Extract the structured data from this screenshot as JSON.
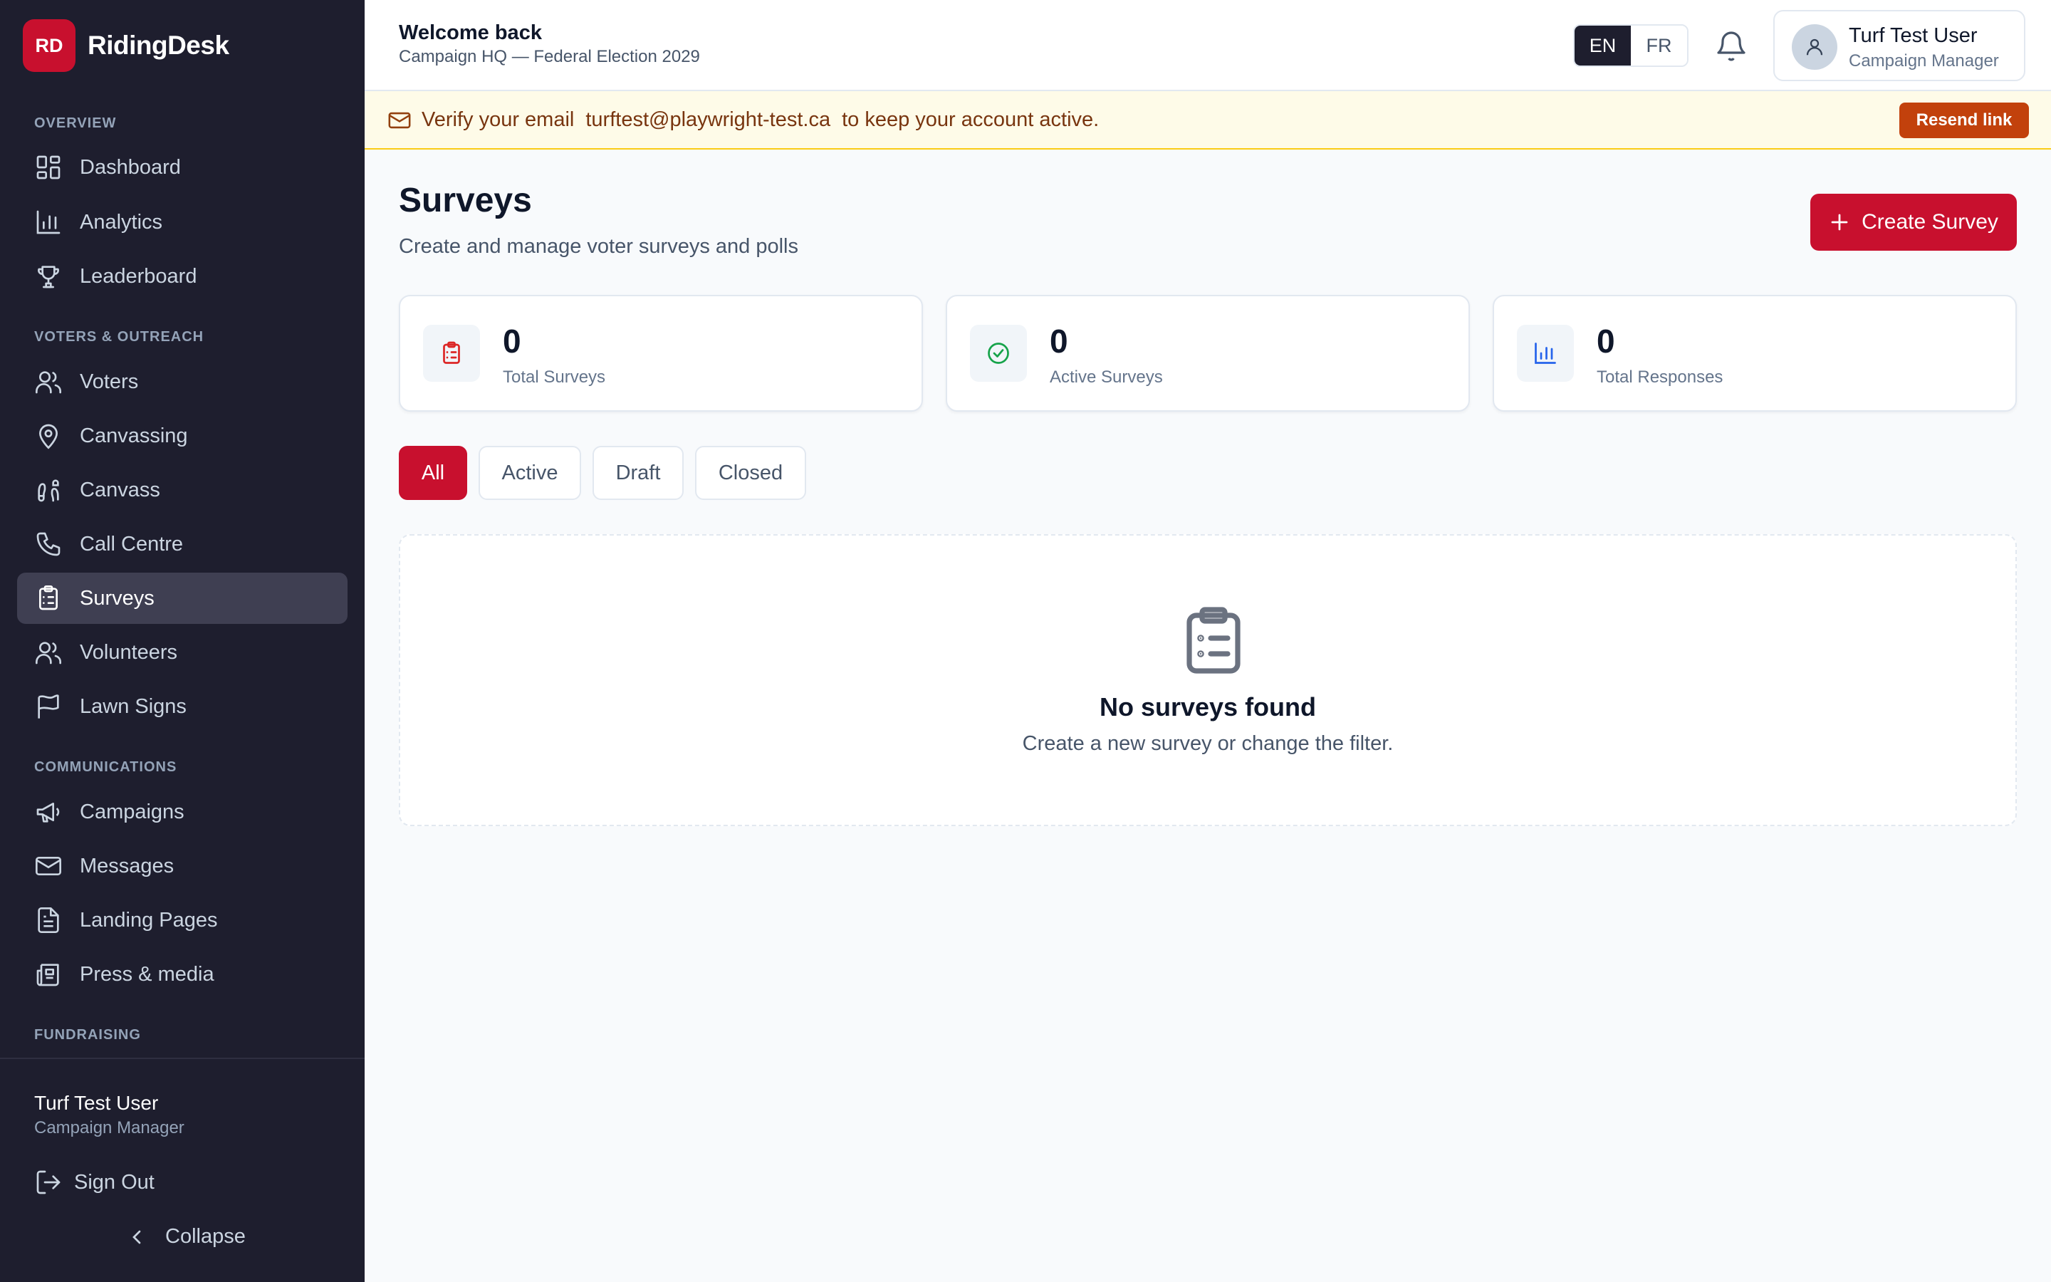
{
  "brand": {
    "logo": "RD",
    "name": "RidingDesk"
  },
  "sidebar": {
    "sections": {
      "overview": "OVERVIEW",
      "voters_outreach": "VOTERS & OUTREACH",
      "communications": "COMMUNICATIONS",
      "fundraising": "FUNDRAISING"
    },
    "items": {
      "dashboard": {
        "label": "Dashboard",
        "icon": "dashboard-icon"
      },
      "analytics": {
        "label": "Analytics",
        "icon": "bar-chart-icon"
      },
      "leaderboard": {
        "label": "Leaderboard",
        "icon": "trophy-icon"
      },
      "voters": {
        "label": "Voters",
        "icon": "users-icon"
      },
      "canvassing": {
        "label": "Canvassing",
        "icon": "map-pin-icon"
      },
      "canvass": {
        "label": "Canvass",
        "icon": "footprints-icon"
      },
      "call_centre": {
        "label": "Call Centre",
        "icon": "phone-icon"
      },
      "surveys": {
        "label": "Surveys",
        "icon": "clipboard-list-icon",
        "active": true
      },
      "volunteers": {
        "label": "Volunteers",
        "icon": "users-icon"
      },
      "lawn_signs": {
        "label": "Lawn Signs",
        "icon": "flag-icon"
      },
      "campaigns": {
        "label": "Campaigns",
        "icon": "megaphone-icon"
      },
      "messages": {
        "label": "Messages",
        "icon": "mail-icon"
      },
      "landing_pages": {
        "label": "Landing Pages",
        "icon": "file-text-icon"
      },
      "press_media": {
        "label": "Press & media",
        "icon": "newspaper-icon"
      }
    },
    "user": {
      "name": "Turf Test User",
      "role": "Campaign Manager"
    },
    "sign_out": "Sign Out",
    "collapse": "Collapse"
  },
  "header": {
    "welcome": "Welcome back",
    "subtitle": "Campaign HQ — Federal Election 2029",
    "lang": {
      "en": "EN",
      "fr": "FR",
      "selected": "EN"
    },
    "user": {
      "name": "Turf Test User",
      "role": "Campaign Manager"
    }
  },
  "banner": {
    "prefix": "Verify your email",
    "email": "turftest@playwright-test.ca",
    "suffix": "to keep your account active.",
    "button": "Resend link"
  },
  "page": {
    "title": "Surveys",
    "subtitle": "Create and manage voter surveys and polls",
    "create_button": "Create Survey"
  },
  "stats": [
    {
      "value": "0",
      "label": "Total Surveys",
      "color": "#dc2626",
      "icon": "clipboard-list-icon"
    },
    {
      "value": "0",
      "label": "Active Surveys",
      "color": "#16a34a",
      "icon": "check-circle-icon"
    },
    {
      "value": "0",
      "label": "Total Responses",
      "color": "#2563eb",
      "icon": "bar-chart-icon"
    }
  ],
  "filters": {
    "all": "All",
    "active": "Active",
    "draft": "Draft",
    "closed": "Closed",
    "selected": "All"
  },
  "empty": {
    "title": "No surveys found",
    "subtitle": "Create a new survey or change the filter."
  },
  "colors": {
    "accent": "#c8102e",
    "sidebar_bg": "#1e1e2e",
    "banner_bg": "#fefbe8",
    "resend_bg": "#c2410c"
  }
}
